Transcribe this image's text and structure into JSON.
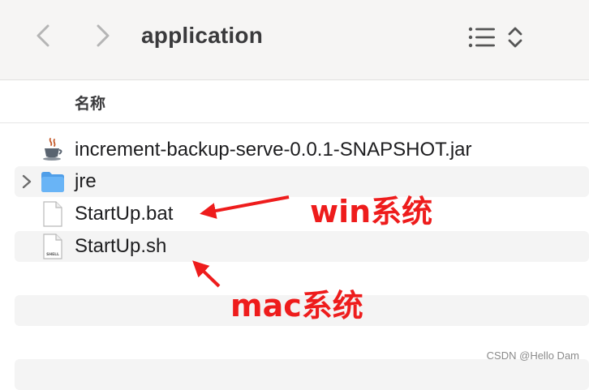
{
  "window": {
    "title": "application"
  },
  "columns": {
    "name": "名称"
  },
  "files": [
    {
      "name": "increment-backup-serve-0.0.1-SNAPSHOT.jar",
      "icon": "java-cup-icon"
    },
    {
      "name": "jre",
      "icon": "folder-icon"
    },
    {
      "name": "StartUp.bat",
      "icon": "document-icon"
    },
    {
      "name": "StartUp.sh",
      "icon": "shell-script-icon",
      "icon_label": "SHELL"
    }
  ],
  "annotations": {
    "win": "win系统",
    "mac": "mac系统"
  },
  "watermark": "CSDN @Hello Dam",
  "colors": {
    "annotation": "#ee1c1c",
    "folder": "#5aa8f0",
    "toolbar_bg": "#f6f5f4"
  }
}
